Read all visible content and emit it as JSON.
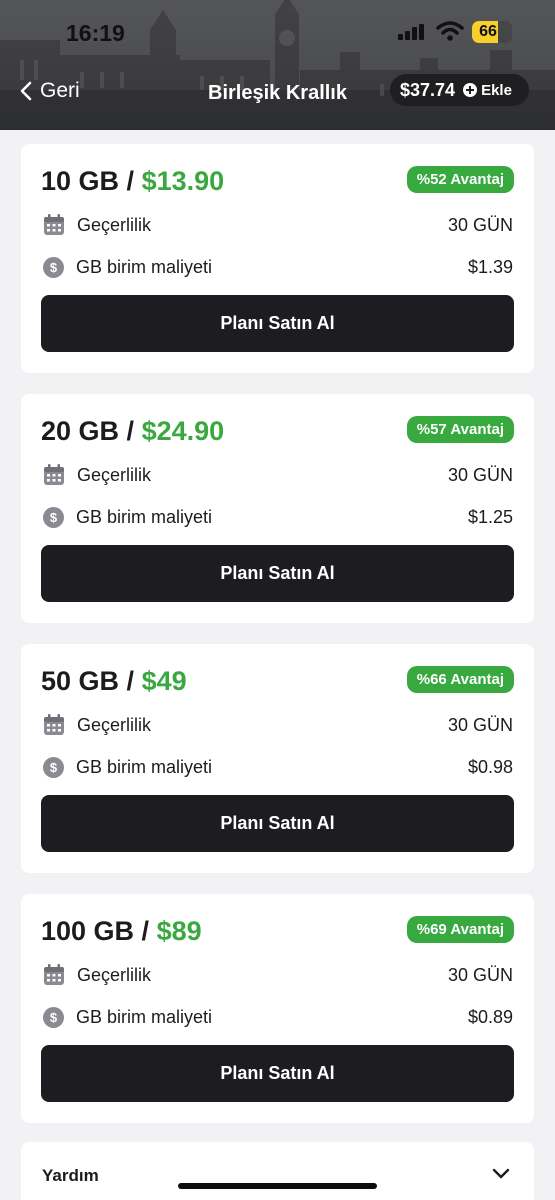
{
  "status_bar": {
    "time": "16:19",
    "battery": "66",
    "battery_level": 0.66
  },
  "nav": {
    "back_label": "Geri",
    "title": "Birleşik Krallık",
    "balance": "$37.74",
    "add_label": "Ekle"
  },
  "plans": [
    {
      "size": "10 GB /",
      "price": "$13.90",
      "advantage": "%52 Avantaj",
      "validity_label": "Geçerlilik",
      "validity_value": "30 GÜN",
      "unit_cost_label": "GB birim maliyeti",
      "unit_cost_value": "$1.39",
      "buy_label": "Planı Satın Al"
    },
    {
      "size": "20 GB /",
      "price": "$24.90",
      "advantage": "%57 Avantaj",
      "validity_label": "Geçerlilik",
      "validity_value": "30 GÜN",
      "unit_cost_label": "GB birim maliyeti",
      "unit_cost_value": "$1.25",
      "buy_label": "Planı Satın Al"
    },
    {
      "size": "50 GB /",
      "price": "$49",
      "advantage": "%66 Avantaj",
      "validity_label": "Geçerlilik",
      "validity_value": "30 GÜN",
      "unit_cost_label": "GB birim maliyeti",
      "unit_cost_value": "$0.98",
      "buy_label": "Planı Satın Al"
    },
    {
      "size": "100 GB /",
      "price": "$89",
      "advantage": "%69 Avantaj",
      "validity_label": "Geçerlilik",
      "validity_value": "30 GÜN",
      "unit_cost_label": "GB birim maliyeti",
      "unit_cost_value": "$0.89",
      "buy_label": "Planı Satın Al"
    }
  ],
  "help": {
    "label": "Yardım"
  },
  "colors": {
    "accent_green": "#3aa83f",
    "badge_green": "#37a93f",
    "button_dark": "#1d1d21",
    "battery_yellow": "#f7d02b"
  },
  "icons": {
    "validity": "calendar-icon",
    "unit_cost": "dollar-coin-icon",
    "back": "chevron-left-icon",
    "add": "plus-circle-icon",
    "help": "chevron-down-icon"
  }
}
